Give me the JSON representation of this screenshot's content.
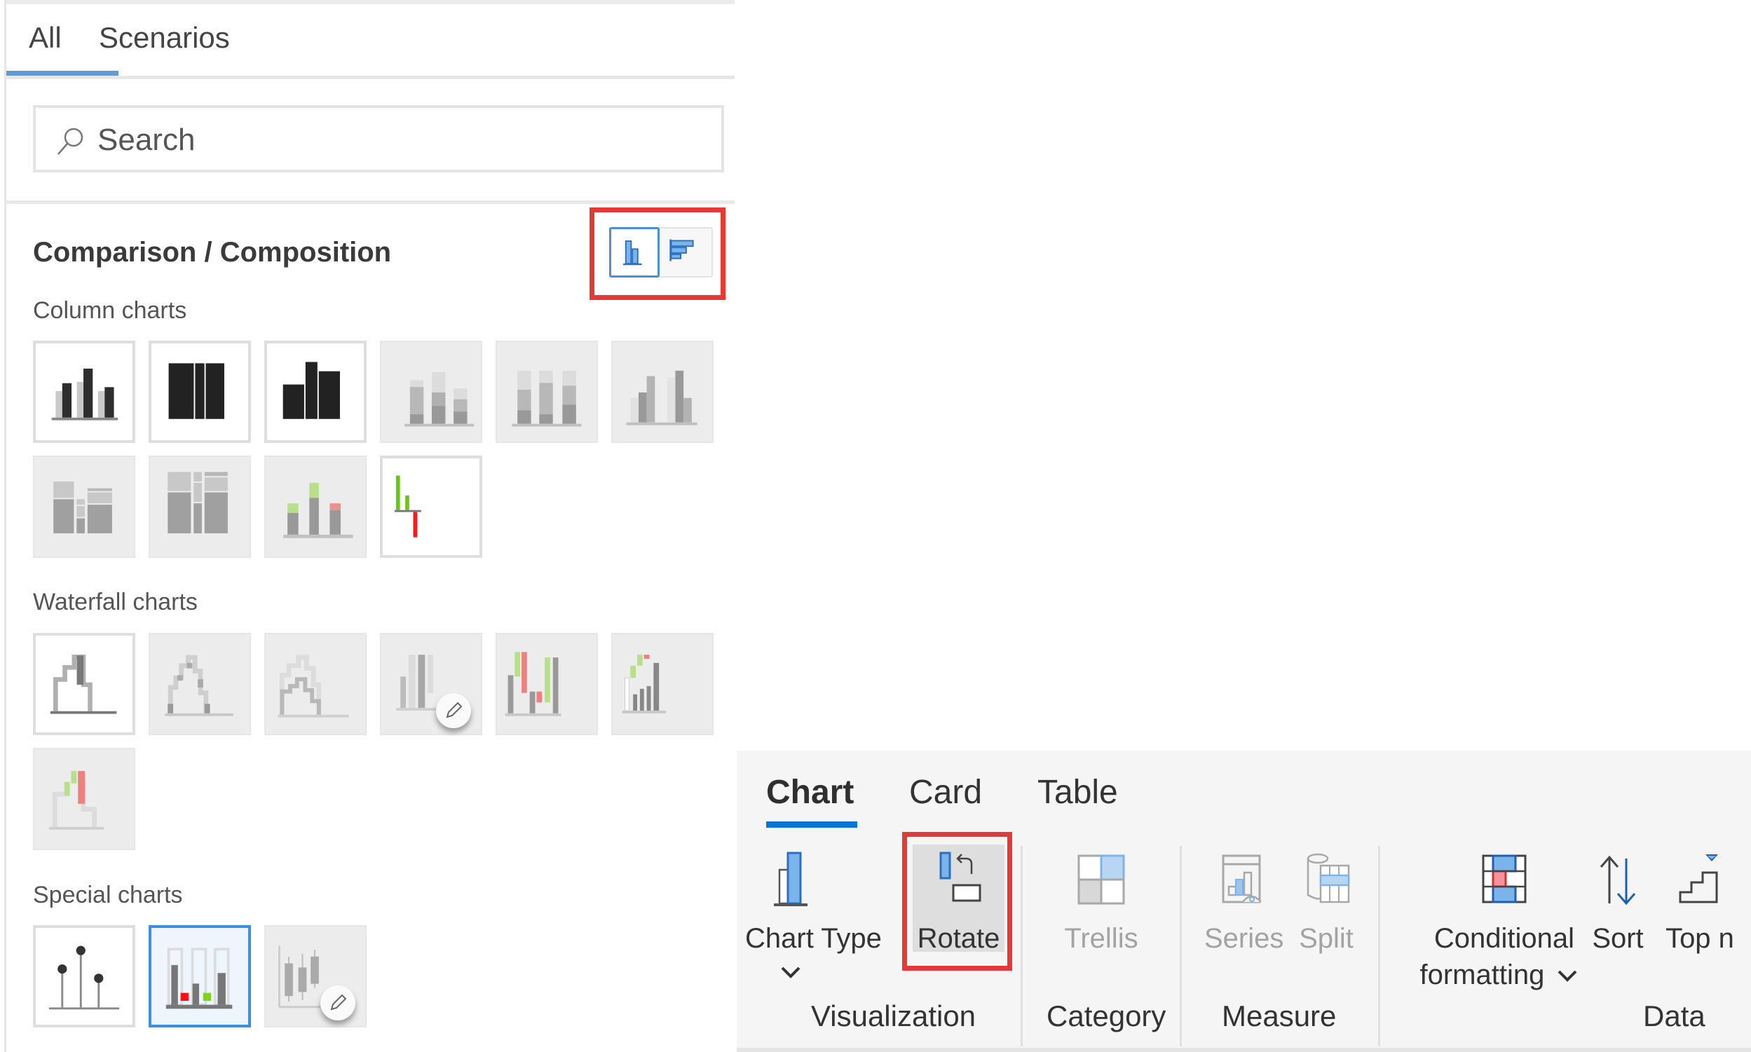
{
  "left_panel": {
    "tabs": [
      {
        "label": "All",
        "active": true
      },
      {
        "label": "Scenarios",
        "active": false
      }
    ],
    "search": {
      "placeholder": "Search",
      "value": "",
      "icon": "search-icon"
    },
    "section_title": "Comparison / Composition",
    "orientation_toggle": {
      "options": [
        {
          "name": "vertical-columns",
          "icon": "column-chart-orientation-icon",
          "selected": true
        },
        {
          "name": "horizontal-bars",
          "icon": "bar-chart-orientation-icon",
          "selected": false
        }
      ],
      "highlighted": true
    },
    "groups": [
      {
        "title": "Column charts",
        "items": [
          {
            "icon": "grouped-column-chart-icon",
            "state": "enabled"
          },
          {
            "icon": "full-width-column-chart-icon",
            "state": "enabled"
          },
          {
            "icon": "variable-width-column-chart-icon",
            "state": "enabled"
          },
          {
            "icon": "stacked-column-chart-icon",
            "state": "disabled"
          },
          {
            "icon": "100-percent-stacked-column-chart-icon",
            "state": "disabled"
          },
          {
            "icon": "overlapping-column-chart-icon",
            "state": "disabled"
          },
          {
            "icon": "marimekko-chart-icon",
            "state": "disabled"
          },
          {
            "icon": "mosaic-chart-icon",
            "state": "disabled"
          },
          {
            "icon": "variance-stacked-column-chart-icon",
            "state": "disabled"
          },
          {
            "icon": "variance-column-chart-icon",
            "state": "enabled"
          }
        ]
      },
      {
        "title": "Waterfall charts",
        "items": [
          {
            "icon": "waterfall-chart-icon",
            "state": "enabled"
          },
          {
            "icon": "stacked-waterfall-chart-icon",
            "state": "disabled"
          },
          {
            "icon": "stacked-waterfall-totals-icon",
            "state": "disabled"
          },
          {
            "icon": "custom-waterfall-chart-icon",
            "state": "disabled",
            "editable": true
          },
          {
            "icon": "variance-waterfall-chart-icon",
            "state": "disabled"
          },
          {
            "icon": "bridge-waterfall-chart-icon",
            "state": "disabled"
          },
          {
            "icon": "delta-waterfall-chart-icon",
            "state": "disabled"
          }
        ]
      },
      {
        "title": "Special charts",
        "items": [
          {
            "icon": "lollipop-chart-icon",
            "state": "enabled"
          },
          {
            "icon": "progress-variance-chart-icon",
            "state": "selected"
          },
          {
            "icon": "box-plot-chart-icon",
            "state": "disabled",
            "editable": true
          }
        ]
      }
    ]
  },
  "ribbon": {
    "tabs": [
      {
        "label": "Chart",
        "active": true
      },
      {
        "label": "Card",
        "active": false
      },
      {
        "label": "Table",
        "active": false
      }
    ],
    "groups": [
      {
        "label": "Visualization",
        "buttons": [
          {
            "label": "Chart Type",
            "icon": "chart-type-icon",
            "dropdown": true,
            "enabled": true
          },
          {
            "label": "Rotate",
            "icon": "rotate-icon",
            "enabled": true,
            "highlighted": true
          }
        ]
      },
      {
        "label": "Category",
        "buttons": [
          {
            "label": "Trellis",
            "icon": "trellis-icon",
            "enabled": false
          }
        ]
      },
      {
        "label": "Measure",
        "buttons": [
          {
            "label": "Series",
            "icon": "series-icon",
            "enabled": false
          },
          {
            "label": "Split",
            "icon": "split-icon",
            "enabled": false
          }
        ]
      },
      {
        "label": "Data",
        "buttons": [
          {
            "label": "Conditional",
            "label_line2": "formatting",
            "icon": "conditional-formatting-icon",
            "dropdown": true,
            "enabled": true
          },
          {
            "label": "Sort",
            "icon": "sort-icon",
            "enabled": true
          },
          {
            "label": "Top n",
            "icon": "top-n-icon",
            "enabled": true
          }
        ]
      }
    ]
  },
  "colors": {
    "accent_blue": "#0a74d4",
    "tab_underline_blue": "#5b9be0",
    "highlight_red": "#e53935",
    "icon_blue_fill": "#7ab4ea",
    "positive_green": "#7ed321",
    "negative_red": "#ff0000",
    "ribbon_background": "#f5f5f5"
  }
}
